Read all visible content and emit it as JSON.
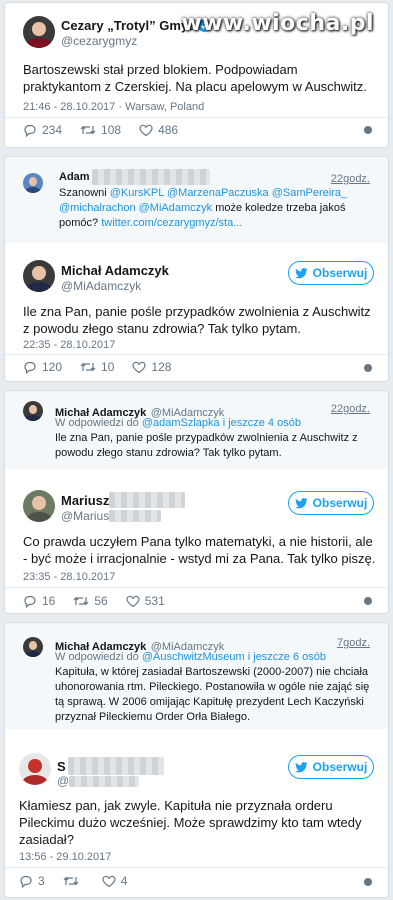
{
  "watermark": "www.wiocha.pl",
  "tweet1": {
    "name": "Cezary „Trotyl” Gmyz",
    "handle": "@cezarygmyz",
    "text": "Bartoszewski stał przed blokiem. Podpowiadam praktykantom z Czerskiej. Na placu apelowym w Auschwitz.",
    "meta": "21:46 - 28.10.2017 · Warsaw, Poland",
    "replies": "234",
    "retweets": "108",
    "likes": "486"
  },
  "card2": {
    "quote": {
      "name": "Adam",
      "time": "22godz.",
      "text_prefix": "Szanowni",
      "mentions": "@KursKPL @MarzenaPaczuska @SamPereira_",
      "mention2": "@michalrachon @MiAdamczyk",
      "text_mid": " może koledze trzeba jakoś",
      "text_end": "pomóc? ",
      "link": "twitter.com/cezarygmyz/sta..."
    },
    "tweet": {
      "name": "Michał Adamczyk",
      "handle": "@MiAdamczyk",
      "follow": "Obserwuj",
      "text": "Ile zna Pan, panie pośle przypadków zwolnienia z Auschwitz z powodu złego stanu zdrowia? Tak tylko pytam.",
      "meta": "22:35 - 28.10.2017",
      "replies": "120",
      "retweets": "10",
      "likes": "128"
    }
  },
  "card3": {
    "quote": {
      "name": "Michał Adamczyk",
      "handle": "@MiAdamczyk",
      "time": "22godz.",
      "reply_prefix": "W odpowiedzi do ",
      "reply_to": "@adamSzlapka i jeszcze 4 osób",
      "text": "Ile zna Pan, panie pośle przypadków zwolnienia z Auschwitz z powodu złego stanu zdrowia? Tak tylko pytam."
    },
    "tweet": {
      "name": "Mariusz",
      "handle": "@Marius",
      "follow": "Obserwuj",
      "text": "Co prawda uczyłem Pana tylko matematyki, a nie historii, ale - być może i irracjonalnie - wstyd mi za Pana. Tak tylko piszę.",
      "meta": "23:35 - 28.10.2017",
      "replies": "16",
      "retweets": "56",
      "likes": "531"
    }
  },
  "card4": {
    "quote": {
      "name": "Michał Adamczyk",
      "handle": "@MiAdamczyk",
      "time": "7godz.",
      "reply_prefix": "W odpowiedzi do ",
      "reply_to": "@AuschwitzMuseum i jeszcze 6 osób",
      "text": "Kapituła, w której zasiadał Bartoszewski (2000-2007) nie chciała uhonorowania rtm. Pileckiego. Postanowiła w ogóle nie zająć się tą sprawą. W 2006 omijając Kapitułę prezydent Lech Kaczyński przyznał Pileckiemu Order Orła Białego."
    },
    "tweet": {
      "name": "S",
      "handle": "@",
      "follow": "Obserwuj",
      "text": "Kłamiesz pan, jak zwyle. Kapituła nie przyznała orderu Pileckimu dużo wcześniej. Może sprawdzimy kto tam wtedy zasiadał?",
      "meta": "13:56 - 29.10.2017",
      "replies": "3",
      "retweets": "",
      "likes": "4"
    }
  },
  "colors": {
    "accent": "#1da1f2",
    "muted": "#657786",
    "background": "#e6ecf0"
  }
}
